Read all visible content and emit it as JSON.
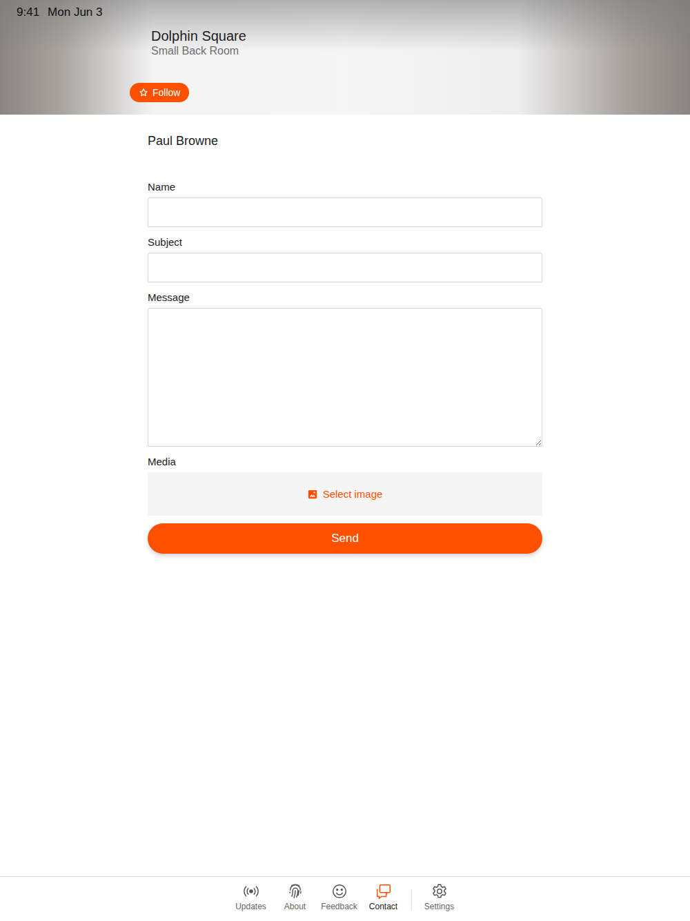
{
  "status_bar": {
    "time": "9:41",
    "date": "Mon Jun 3"
  },
  "header": {
    "title": "Dolphin Square",
    "subtitle": "Small Back Room",
    "follow_button": "Follow"
  },
  "form": {
    "recipient": "Paul Browne",
    "fields": [
      {
        "label": "Name",
        "kind": "text",
        "value": ""
      },
      {
        "label": "Subject",
        "kind": "text",
        "value": ""
      },
      {
        "label": "Message",
        "kind": "textarea",
        "value": ""
      }
    ],
    "media": {
      "label": "Media",
      "button": "Select image"
    },
    "send_button": "Send"
  },
  "tabs": [
    {
      "label": "Updates",
      "selected": false
    },
    {
      "label": "About",
      "selected": false
    },
    {
      "label": "Feedback",
      "selected": false
    },
    {
      "label": "Contact",
      "selected": true
    },
    {
      "label": "Settings",
      "selected": false
    }
  ]
}
